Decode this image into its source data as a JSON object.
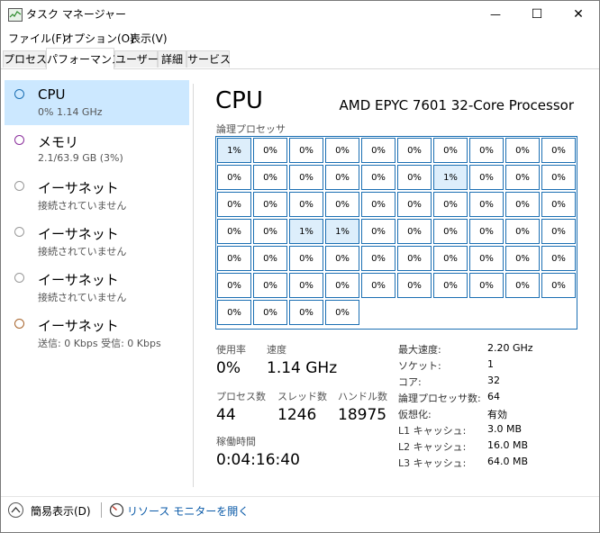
{
  "window": {
    "title": "タスク マネージャー",
    "minimize_glyph": "—",
    "maximize_glyph": "☐",
    "close_glyph": "✕"
  },
  "menu": [
    {
      "label": "ファイル(F)"
    },
    {
      "label": "オプション(O)"
    },
    {
      "label": "表示(V)"
    }
  ],
  "tabs": [
    {
      "label": "プロセス",
      "active": false
    },
    {
      "label": "パフォーマンス",
      "active": true
    },
    {
      "label": "ユーザー",
      "active": false
    },
    {
      "label": "詳細",
      "active": false
    },
    {
      "label": "サービス",
      "active": false
    }
  ],
  "sidebar": {
    "items": [
      {
        "label": "CPU",
        "sub": "0%  1.14 GHz",
        "color": "#1b6fb3",
        "selected": true
      },
      {
        "label": "メモリ",
        "sub": "2.1/63.9 GB (3%)",
        "color": "#8b2f9c",
        "selected": false
      },
      {
        "label": "イーサネット",
        "sub": "接続されていません",
        "color": "#999999",
        "selected": false
      },
      {
        "label": "イーサネット",
        "sub": "接続されていません",
        "color": "#999999",
        "selected": false
      },
      {
        "label": "イーサネット",
        "sub": "接続されていません",
        "color": "#999999",
        "selected": false
      },
      {
        "label": "イーサネット",
        "sub": "送信: 0 Kbps  受信: 0 Kbps",
        "color": "#a7642b",
        "selected": false
      }
    ]
  },
  "cpu": {
    "title": "CPU",
    "model": "AMD EPYC 7601 32-Core Processor",
    "grid_label": "論理プロセッサ",
    "cores": [
      "1%",
      "0%",
      "0%",
      "0%",
      "0%",
      "0%",
      "0%",
      "0%",
      "0%",
      "0%",
      "0%",
      "0%",
      "0%",
      "0%",
      "0%",
      "0%",
      "1%",
      "0%",
      "0%",
      "0%",
      "0%",
      "0%",
      "0%",
      "0%",
      "0%",
      "0%",
      "0%",
      "0%",
      "0%",
      "0%",
      "0%",
      "0%",
      "1%",
      "1%",
      "0%",
      "0%",
      "0%",
      "0%",
      "0%",
      "0%",
      "0%",
      "0%",
      "0%",
      "0%",
      "0%",
      "0%",
      "0%",
      "0%",
      "0%",
      "0%",
      "0%",
      "0%",
      "0%",
      "0%",
      "0%",
      "0%",
      "0%",
      "0%",
      "0%",
      "0%",
      "0%",
      "0%",
      "0%",
      "0%"
    ],
    "highlight_indexes": [
      0,
      16,
      32,
      33
    ]
  },
  "stats": {
    "usage_label": "使用率",
    "usage_value": "0%",
    "speed_label": "速度",
    "speed_value": "1.14 GHz",
    "processes_label": "プロセス数",
    "processes_value": "44",
    "threads_label": "スレッド数",
    "threads_value": "1246",
    "handles_label": "ハンドル数",
    "handles_value": "18975",
    "uptime_label": "稼働時間",
    "uptime_value": "0:04:16:40"
  },
  "info": [
    {
      "key": "最大速度:",
      "value": "2.20 GHz"
    },
    {
      "key": "ソケット:",
      "value": "1"
    },
    {
      "key": "コア:",
      "value": "32"
    },
    {
      "key": "論理プロセッサ数:",
      "value": "64"
    },
    {
      "key": "仮想化:",
      "value": "有効"
    },
    {
      "key": "L1 キャッシュ:",
      "value": "3.0 MB"
    },
    {
      "key": "L2 キャッシュ:",
      "value": "16.0 MB"
    },
    {
      "key": "L3 キャッシュ:",
      "value": "64.0 MB"
    }
  ],
  "footer": {
    "simple_view": "簡易表示(D)",
    "resource_monitor": "リソース モニターを開く"
  }
}
